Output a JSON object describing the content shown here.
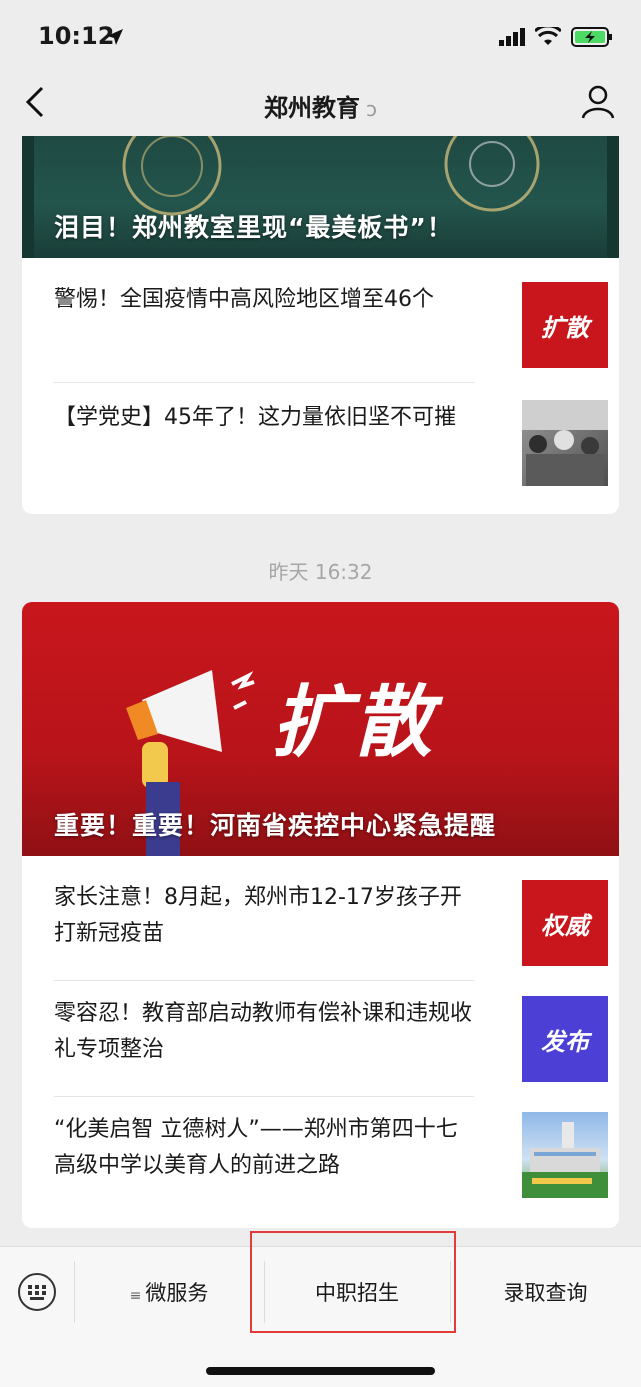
{
  "status": {
    "time": "10:12"
  },
  "nav": {
    "title": "郑州教育"
  },
  "card1": {
    "hero_caption": "泪目！郑州教室里现“最美板书”！",
    "items": [
      {
        "title": "警惕！全国疫情中高风险地区增至46个",
        "thumb_label": "扩散",
        "thumb_color": "#c8161c"
      },
      {
        "title": "【学党史】45年了！这力量依旧坚不可摧",
        "thumb_label": "",
        "thumb_color": "#7a7a7a"
      }
    ]
  },
  "timestamp": "昨天 16:32",
  "card2": {
    "hero_word": "扩散",
    "hero_caption": "重要！重要！河南省疾控中心紧急提醒",
    "items": [
      {
        "title": "家长注意！8月起，郑州市12-17岁孩子开打新冠疫苗",
        "thumb_label": "权威",
        "thumb_color": "#c8161c"
      },
      {
        "title": "零容忍！教育部启动教师有偿补课和违规收礼专项整治",
        "thumb_label": "发布",
        "thumb_color": "#4b3fd6"
      },
      {
        "title": "“化美启智 立德树人”——郑州市第四十七高级中学以美育人的前进之路",
        "thumb_label": "",
        "thumb_color": "#5b8ec9"
      }
    ]
  },
  "bottom_menu": {
    "items": [
      {
        "label": "微服务"
      },
      {
        "label": "中职招生"
      },
      {
        "label": "录取查询"
      }
    ],
    "highlight_color": "#e23b3b"
  }
}
